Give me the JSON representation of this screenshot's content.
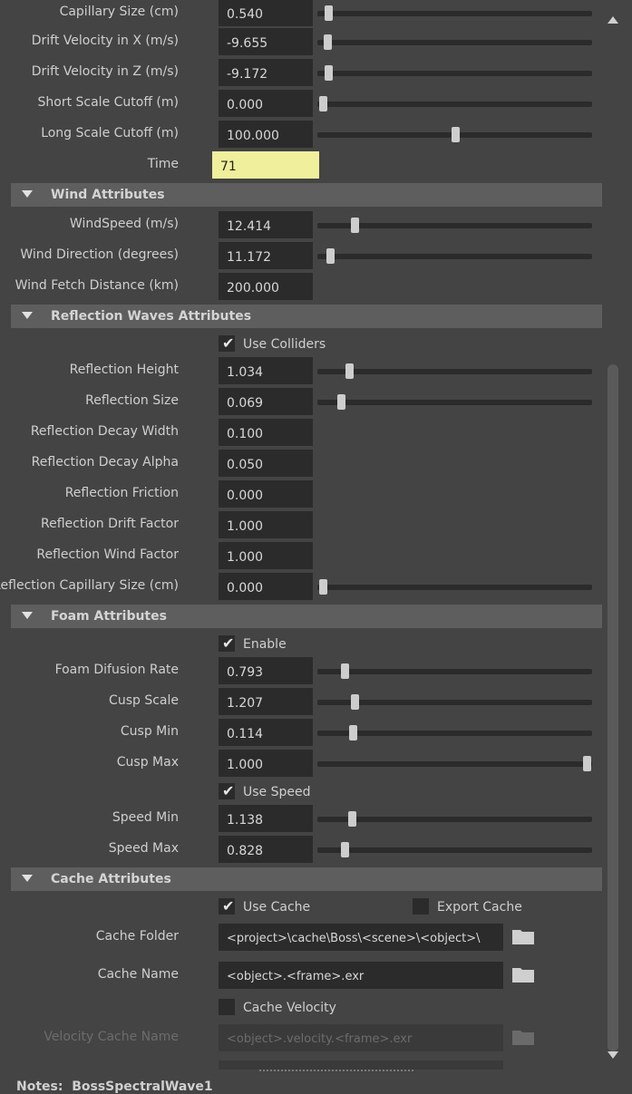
{
  "top_partial": {
    "label": "Capillary Size (cm)",
    "value": "0.540",
    "slider": 0.04
  },
  "ocean": [
    {
      "label": "Drift Velocity in X (m/s)",
      "value": "-9.655",
      "slider": 0.035
    },
    {
      "label": "Drift Velocity in Z (m/s)",
      "value": "-9.172",
      "slider": 0.04
    },
    {
      "label": "Short Scale Cutoff (m)",
      "value": "0.000",
      "slider": 0.02
    },
    {
      "label": "Long Scale Cutoff (m)",
      "value": "100.000",
      "slider": 0.5
    }
  ],
  "time": {
    "label": "Time",
    "value": "71",
    "highlight_color": "#f0ef9c"
  },
  "wind": {
    "title": "Wind Attributes",
    "rows": [
      {
        "label": "WindSpeed (m/s)",
        "value": "12.414",
        "slider": 0.135
      },
      {
        "label": "Wind Direction (degrees)",
        "value": "11.172",
        "slider": 0.045
      },
      {
        "label": "Wind Fetch Distance (km)",
        "value": "200.000"
      }
    ]
  },
  "reflection": {
    "title": "Reflection Waves Attributes",
    "use_colliders": {
      "label": "Use Colliders",
      "checked": true
    },
    "rows": [
      {
        "label": "Reflection Height",
        "value": "1.034",
        "slider": 0.115
      },
      {
        "label": "Reflection Size",
        "value": "0.069",
        "slider": 0.085
      },
      {
        "label": "Reflection Decay Width",
        "value": "0.100"
      },
      {
        "label": "Reflection Decay Alpha",
        "value": "0.050"
      },
      {
        "label": "Reflection Friction",
        "value": "0.000"
      },
      {
        "label": "Reflection Drift Factor",
        "value": "1.000"
      },
      {
        "label": "Reflection Wind Factor",
        "value": "1.000"
      },
      {
        "label": "Reflection Capillary Size (cm)",
        "value": "0.000",
        "slider": 0.02
      }
    ]
  },
  "foam": {
    "title": "Foam Attributes",
    "enable": {
      "label": "Enable",
      "checked": true
    },
    "rows_a": [
      {
        "label": "Foam Difusion Rate",
        "value": "0.793",
        "slider": 0.1
      },
      {
        "label": "Cusp Scale",
        "value": "1.207",
        "slider": 0.135
      },
      {
        "label": "Cusp Min",
        "value": "0.114",
        "slider": 0.13
      },
      {
        "label": "Cusp Max",
        "value": "1.000",
        "slider": 0.98
      }
    ],
    "use_speed": {
      "label": "Use Speed",
      "checked": true
    },
    "rows_b": [
      {
        "label": "Speed Min",
        "value": "1.138",
        "slider": 0.125
      },
      {
        "label": "Speed Max",
        "value": "0.828",
        "slider": 0.1
      }
    ]
  },
  "cache": {
    "title": "Cache Attributes",
    "use_cache": {
      "label": "Use Cache",
      "checked": true
    },
    "export_cache": {
      "label": "Export Cache",
      "checked": false
    },
    "folder": {
      "label": "Cache Folder",
      "value": "<project>\\cache\\Boss\\<scene>\\<object>\\"
    },
    "name": {
      "label": "Cache Name",
      "value": "<object>.<frame>.exr"
    },
    "velocity": {
      "label": "Cache Velocity",
      "checked": false
    },
    "velocity_name": {
      "label": "Velocity Cache Name",
      "value": "<object>.velocity.<frame>.exr"
    }
  },
  "notes": {
    "label": "Notes:",
    "node": "BossSpectralWave1"
  },
  "colors": {
    "background": "#444444",
    "header": "#5e5e5e",
    "field": "#2b2b2b",
    "highlight": "#f0ef9c"
  }
}
